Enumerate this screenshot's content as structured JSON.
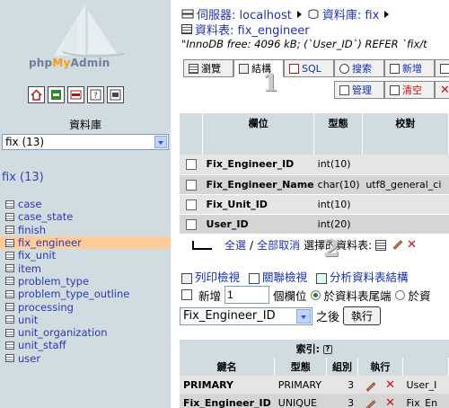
{
  "app": {
    "logo_main": "php",
    "logo_accent": "My",
    "logo_rest": "Admin"
  },
  "left": {
    "quick_icons": [
      "home-icon",
      "exit-icon",
      "sql-icon",
      "help-icon",
      "query-window-icon"
    ],
    "db_label": "資料庫",
    "db_selected": "fix (13)",
    "db_heading": "fix (13)",
    "tables": [
      "case",
      "case_state",
      "finish",
      "fix_engineer",
      "fix_unit",
      "item",
      "problem_type",
      "problem_type_outline",
      "processing",
      "unit",
      "unit_organization",
      "unit_staff",
      "user"
    ],
    "active_table": "fix_engineer"
  },
  "breadcrumb": {
    "server_label": "伺服器: localhost",
    "db_label": "資料庫: fix",
    "table_label": "資料表: fix_engineer"
  },
  "status_line": "\"InnoDB free: 4096 kB; (`User_ID`) REFER `fix/t",
  "tabs": {
    "browse": "瀏覽",
    "structure": "結構",
    "sql": "SQL",
    "search": "搜索",
    "insert": "新增",
    "manage": "管理",
    "empty": "清空"
  },
  "markers": {
    "one": "1",
    "two": "2"
  },
  "structure_table": {
    "headers": [
      "欄位",
      "型態",
      "校對"
    ],
    "rows": [
      {
        "field": "Fix_Engineer_ID",
        "type": "int(10)",
        "collation": ""
      },
      {
        "field": "Fix_Engineer_Name",
        "type": "char(10)",
        "collation": "utf8_general_ci"
      },
      {
        "field": "Fix_Unit_ID",
        "type": "int(10)",
        "collation": ""
      },
      {
        "field": "User_ID",
        "type": "int(20)",
        "collation": ""
      }
    ]
  },
  "bulk": {
    "check_all": "全選",
    "separator": "/",
    "uncheck_all": "全部取消",
    "with_selected": "選擇的資料表:"
  },
  "actions": {
    "print_view": "列印檢視",
    "relation_view": "關聯檢視",
    "analyze": "分析資料表結構"
  },
  "add_field": {
    "label": "新增",
    "count": "1",
    "unit": "個欄位",
    "at_end": "於資料表尾端",
    "at_start": "於資"
  },
  "after_field": {
    "selected": "Fix_Engineer_ID",
    "after_label": "之後",
    "exec_label": "執行"
  },
  "indexes": {
    "caption": "索引:",
    "headers": [
      "鍵名",
      "型態",
      "組別",
      "執行",
      ""
    ],
    "rows": [
      {
        "key": "PRIMARY",
        "type": "PRIMARY",
        "cardinality": "3",
        "field": "User_I"
      },
      {
        "key": "Fix_Engineer_ID",
        "type": "UNIQUE",
        "cardinality": "3",
        "field": "Fix_En"
      }
    ]
  }
}
